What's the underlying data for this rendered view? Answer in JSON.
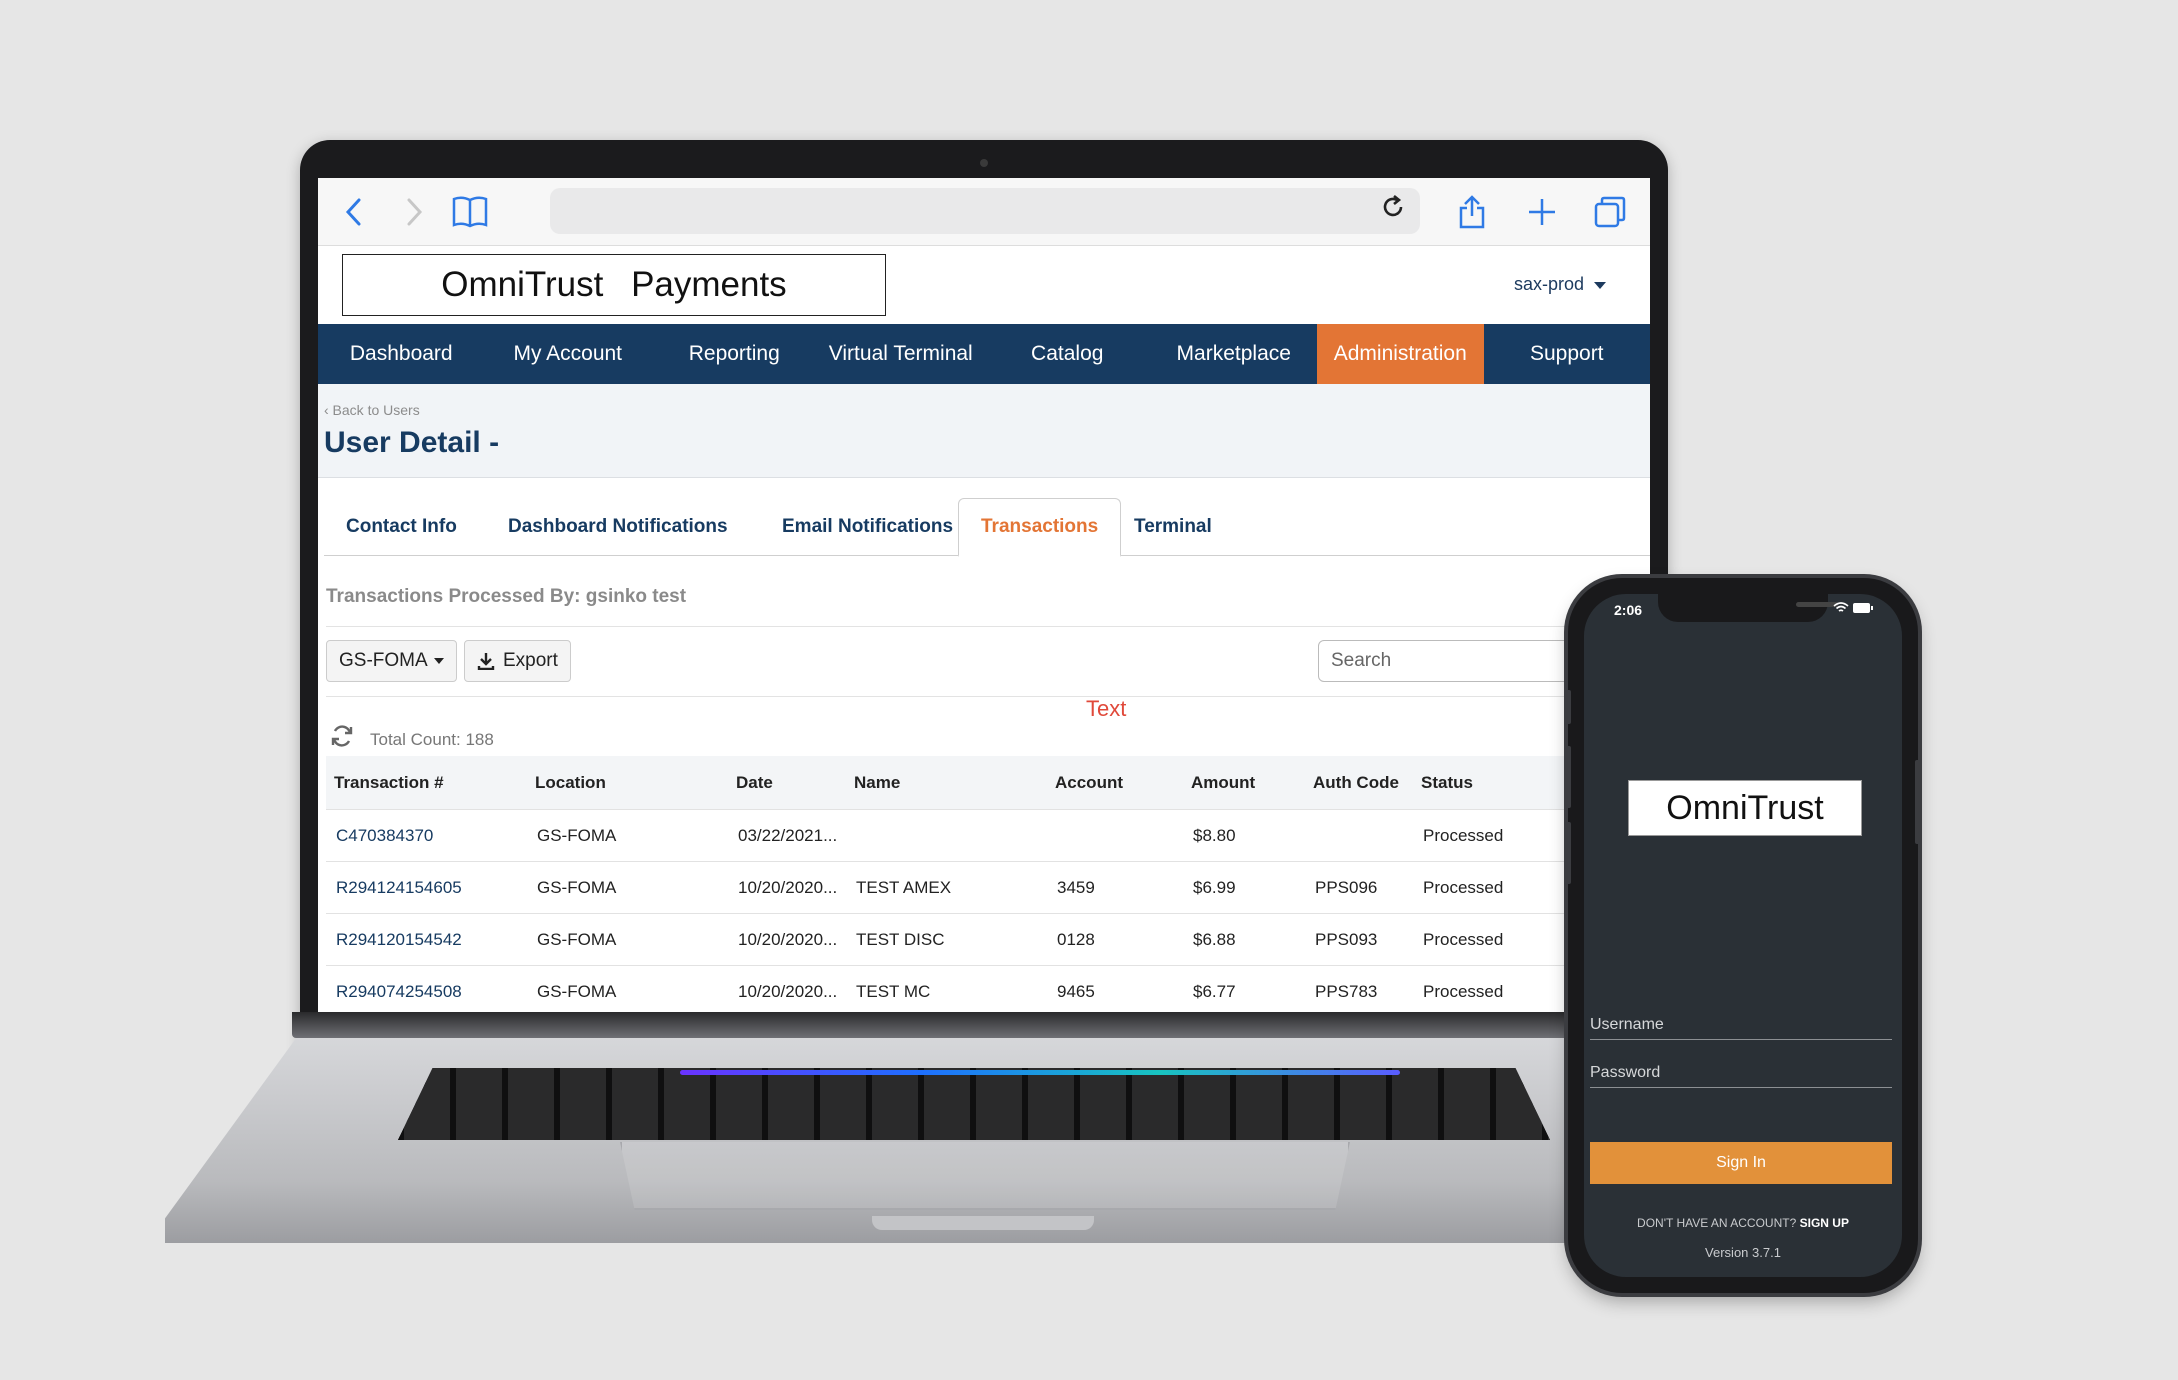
{
  "browser": {
    "icons": {
      "back": "chevron-left-icon",
      "forward": "chevron-right-icon",
      "bookmarks": "book-icon",
      "reload": "reload-icon",
      "share": "share-icon",
      "new_tab": "plus-icon",
      "tabs": "tabs-icon"
    }
  },
  "header": {
    "logo_text": "OmniTrust Payments",
    "environment": "sax-prod"
  },
  "nav": {
    "items": [
      "Dashboard",
      "My Account",
      "Reporting",
      "Virtual Terminal",
      "Catalog",
      "Marketplace",
      "Administration",
      "Support"
    ],
    "active": "Administration"
  },
  "page": {
    "back_link": "‹ Back to Users",
    "title": "User Detail -"
  },
  "tabs": {
    "items": [
      "Contact Info",
      "Dashboard Notifications",
      "Email Notifications",
      "Transactions",
      "Terminal"
    ],
    "active": "Transactions"
  },
  "transactions": {
    "processed_by": "Transactions Processed By: gsinko test",
    "location_filter": "GS-FOMA",
    "export_label": "Export",
    "search_placeholder": "Search",
    "stray_text": "Text",
    "total_count": "Total Count: 188",
    "columns": [
      "Transaction #",
      "Location",
      "Date",
      "Name",
      "Account",
      "Amount",
      "Auth Code",
      "Status"
    ],
    "rows": [
      [
        "C470384370",
        "GS-FOMA",
        "03/22/2021...",
        "",
        "",
        "$8.80",
        "",
        "Processed"
      ],
      [
        "R294124154605",
        "GS-FOMA",
        "10/20/2020...",
        "TEST AMEX",
        "3459",
        "$6.99",
        "PPS096",
        "Processed"
      ],
      [
        "R294120154542",
        "GS-FOMA",
        "10/20/2020...",
        "TEST DISC",
        "0128",
        "$6.88",
        "PPS093",
        "Processed"
      ],
      [
        "R294074254508",
        "GS-FOMA",
        "10/20/2020...",
        "TEST MC",
        "9465",
        "$6.77",
        "PPS783",
        "Processed"
      ]
    ]
  },
  "phone": {
    "time": "2:06",
    "logo_text": "OmniTrust",
    "username_label": "Username",
    "password_label": "Password",
    "signin_label": "Sign In",
    "signup_prompt": "DON'T HAVE AN ACCOUNT?",
    "signup_link": "SIGN UP",
    "version": "Version 3.7.1"
  },
  "colors": {
    "nav_bg": "#173b61",
    "accent": "#e37535",
    "phone_bg": "#2a3036",
    "signin_button": "#e2913a",
    "stray_text": "#e0493a"
  }
}
